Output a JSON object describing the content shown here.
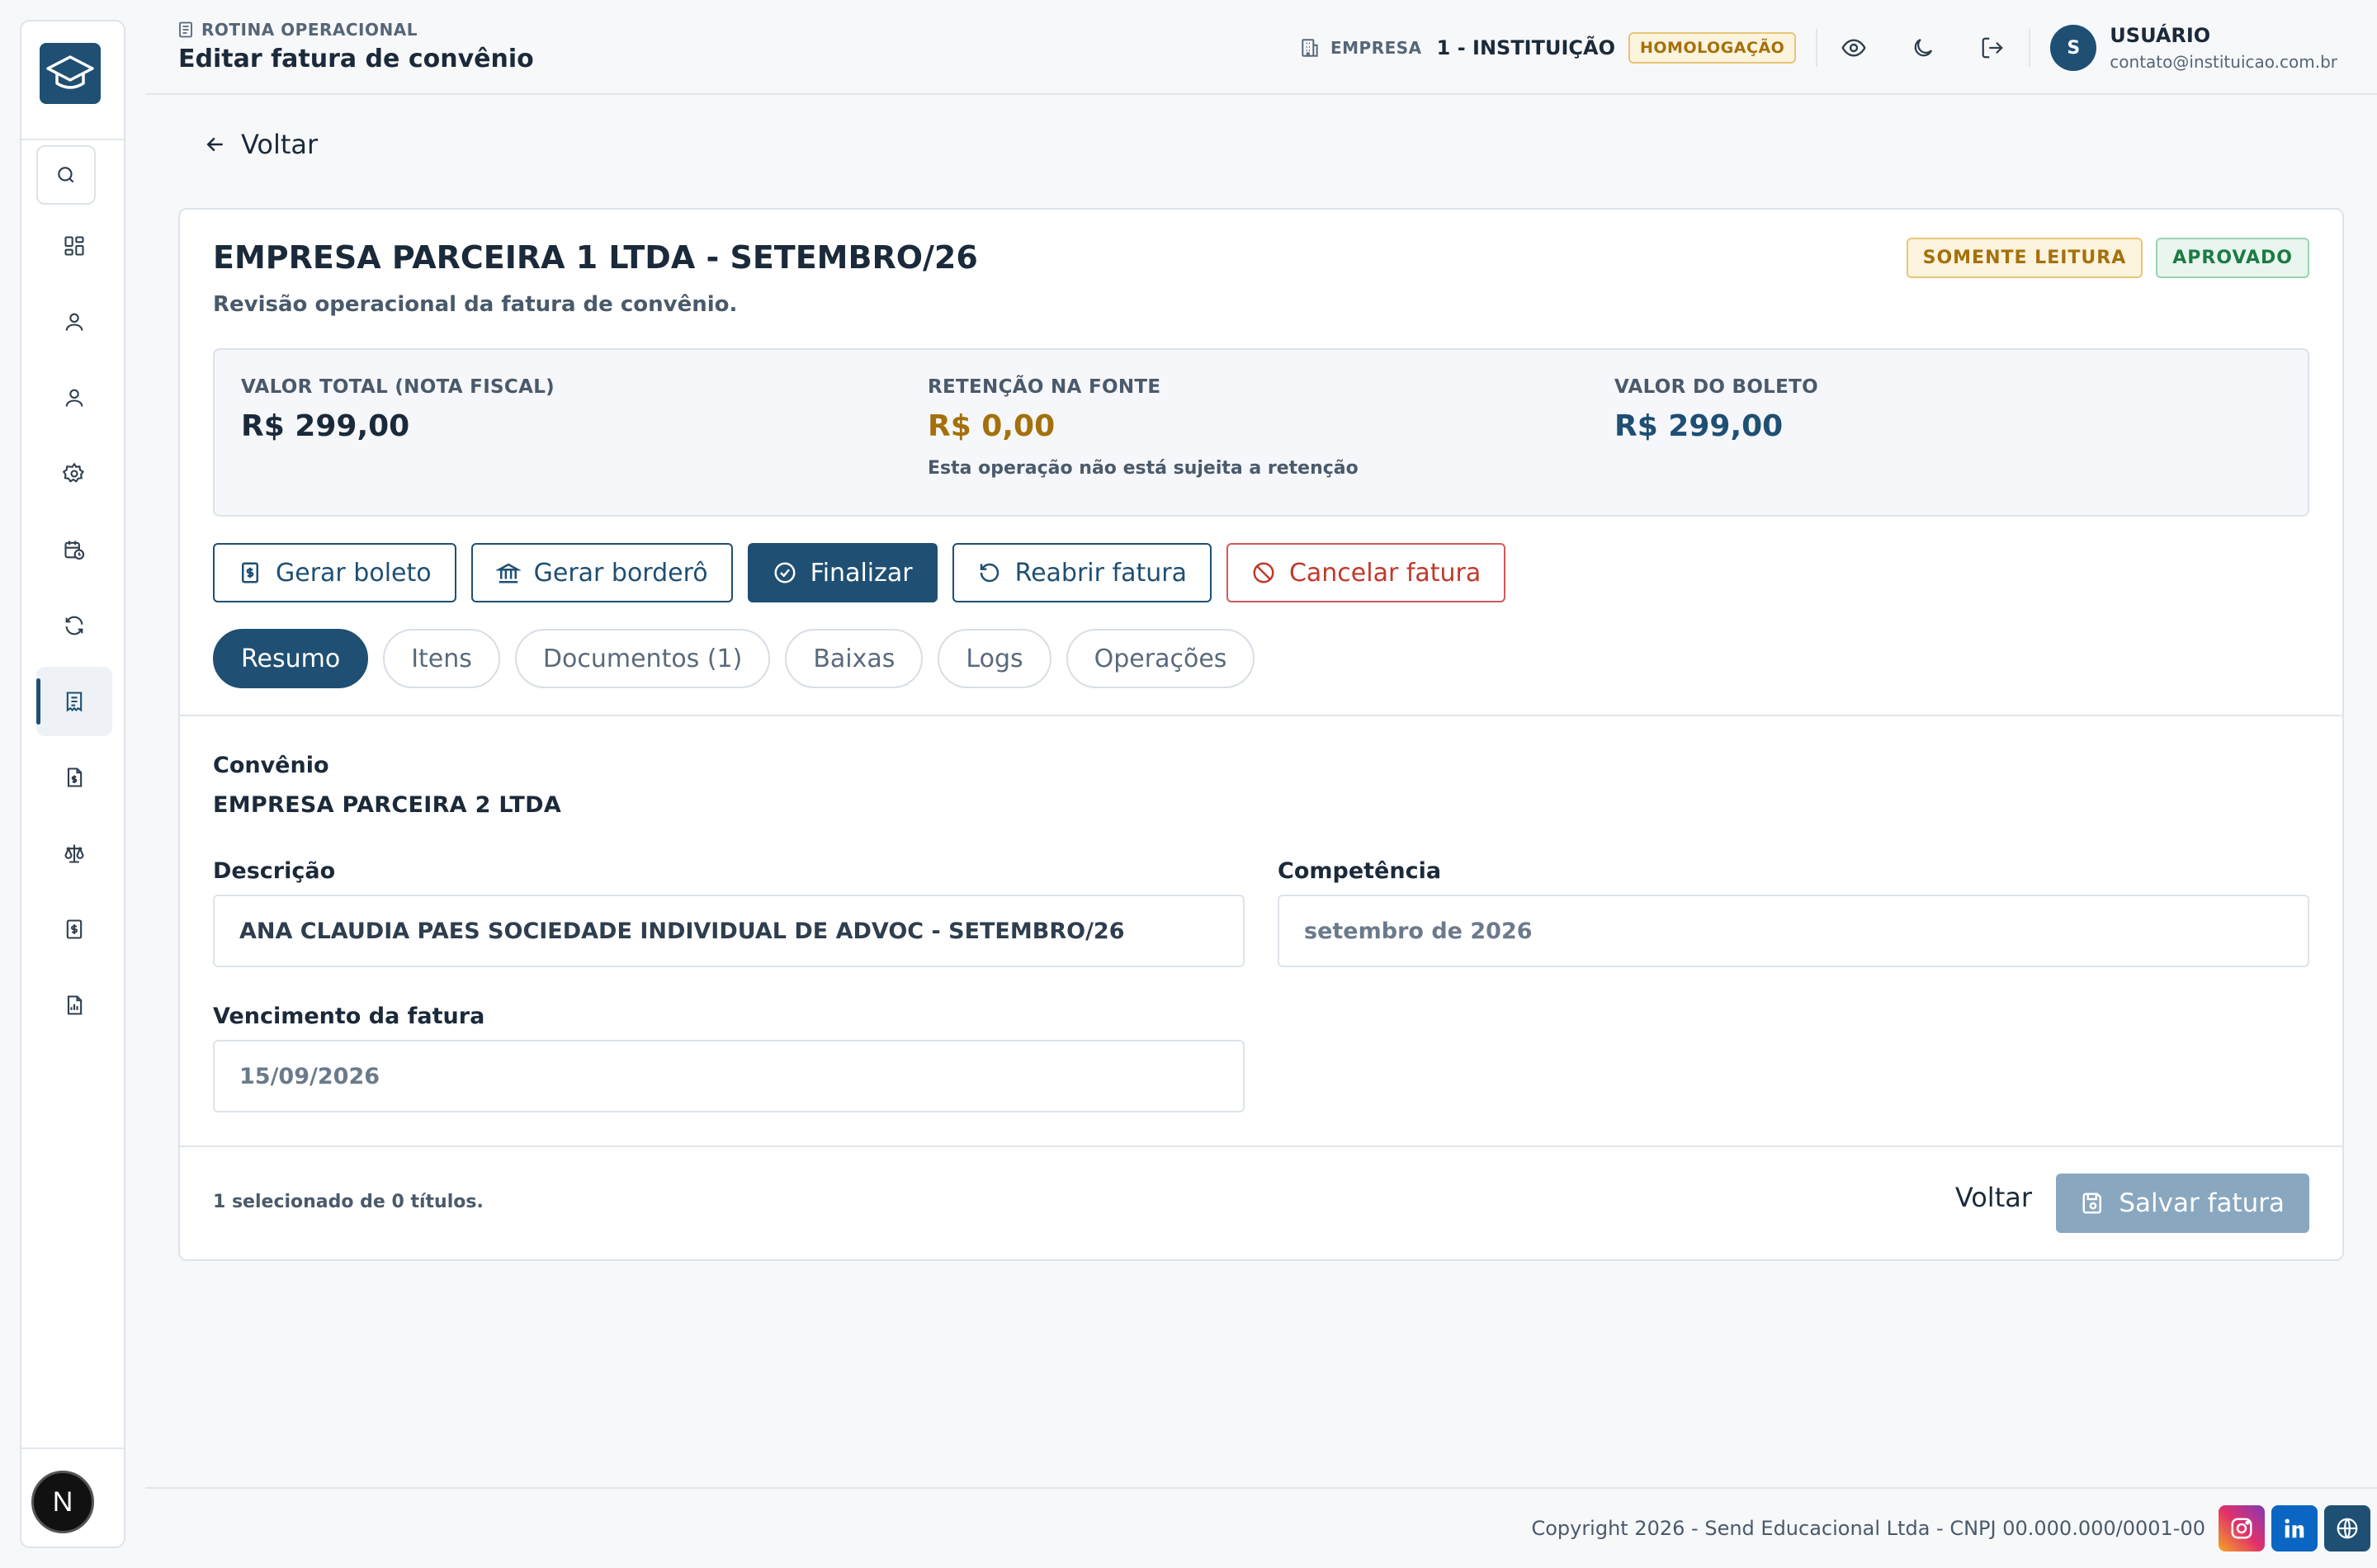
{
  "header": {
    "breadcrumb": "ROTINA OPERACIONAL",
    "title": "Editar fatura de convênio",
    "company_label": "EMPRESA",
    "company_name": "1 - INSTITUIÇÃO",
    "environment": "HOMOLOGAÇÃO",
    "user": {
      "initial": "S",
      "name": "USUÁRIO",
      "email": "contato@instituicao.com.br"
    }
  },
  "sidebar": {
    "items": [
      {
        "icon": "dashboard-icon"
      },
      {
        "icon": "user-icon"
      },
      {
        "icon": "user-icon"
      },
      {
        "icon": "gear-icon"
      },
      {
        "icon": "calendar-clock-icon"
      },
      {
        "icon": "refresh-icon"
      },
      {
        "icon": "invoice-icon",
        "active": true
      },
      {
        "icon": "file-dollar-icon"
      },
      {
        "icon": "scale-icon"
      },
      {
        "icon": "receipt-dollar-icon"
      },
      {
        "icon": "report-icon"
      }
    ],
    "bottom_badge": "N"
  },
  "back_label": "Voltar",
  "invoice": {
    "title": "EMPRESA PARCEIRA 1 LTDA - SETEMBRO/26",
    "subtitle": "Revisão operacional da fatura de convênio.",
    "badges": {
      "readonly": "SOMENTE LEITURA",
      "status": "APROVADO"
    },
    "summary": {
      "total_label": "VALOR TOTAL (NOTA FISCAL)",
      "total_value": "R$ 299,00",
      "retention_label": "RETENÇÃO NA FONTE",
      "retention_value": "R$ 0,00",
      "retention_note": "Esta operação não está sujeita a retenção",
      "boleto_label": "VALOR DO BOLETO",
      "boleto_value": "R$ 299,00"
    },
    "actions": {
      "gerar_boleto": "Gerar boleto",
      "gerar_bordero": "Gerar borderô",
      "finalizar": "Finalizar",
      "reabrir": "Reabrir fatura",
      "cancelar": "Cancelar fatura"
    },
    "tabs": [
      "Resumo",
      "Itens",
      "Documentos (1)",
      "Baixas",
      "Logs",
      "Operações"
    ],
    "active_tab": "Resumo",
    "fields": {
      "convenio_label": "Convênio",
      "convenio_value": "EMPRESA PARCEIRA 2 LTDA",
      "descricao_label": "Descrição",
      "descricao_value": "ANA CLAUDIA PAES SOCIEDADE INDIVIDUAL DE ADVOC - SETEMBRO/26",
      "competencia_label": "Competência",
      "competencia_value": "setembro de 2026",
      "vencimento_label": "Vencimento da fatura",
      "vencimento_value": "15/09/2026"
    },
    "footer": {
      "selection_info": "1 selecionado de 0 títulos.",
      "back": "Voltar",
      "save": "Salvar fatura"
    }
  },
  "page_footer": {
    "copyright": "Copyright 2026 - Send Educacional Ltda - CNPJ 00.000.000/0001-00",
    "social": [
      "instagram-icon",
      "linkedin-icon",
      "globe-icon"
    ]
  },
  "colors": {
    "primary": "#1f4f73",
    "warning": "#a5700c",
    "success": "#1d7a45",
    "danger": "#c0392b"
  }
}
